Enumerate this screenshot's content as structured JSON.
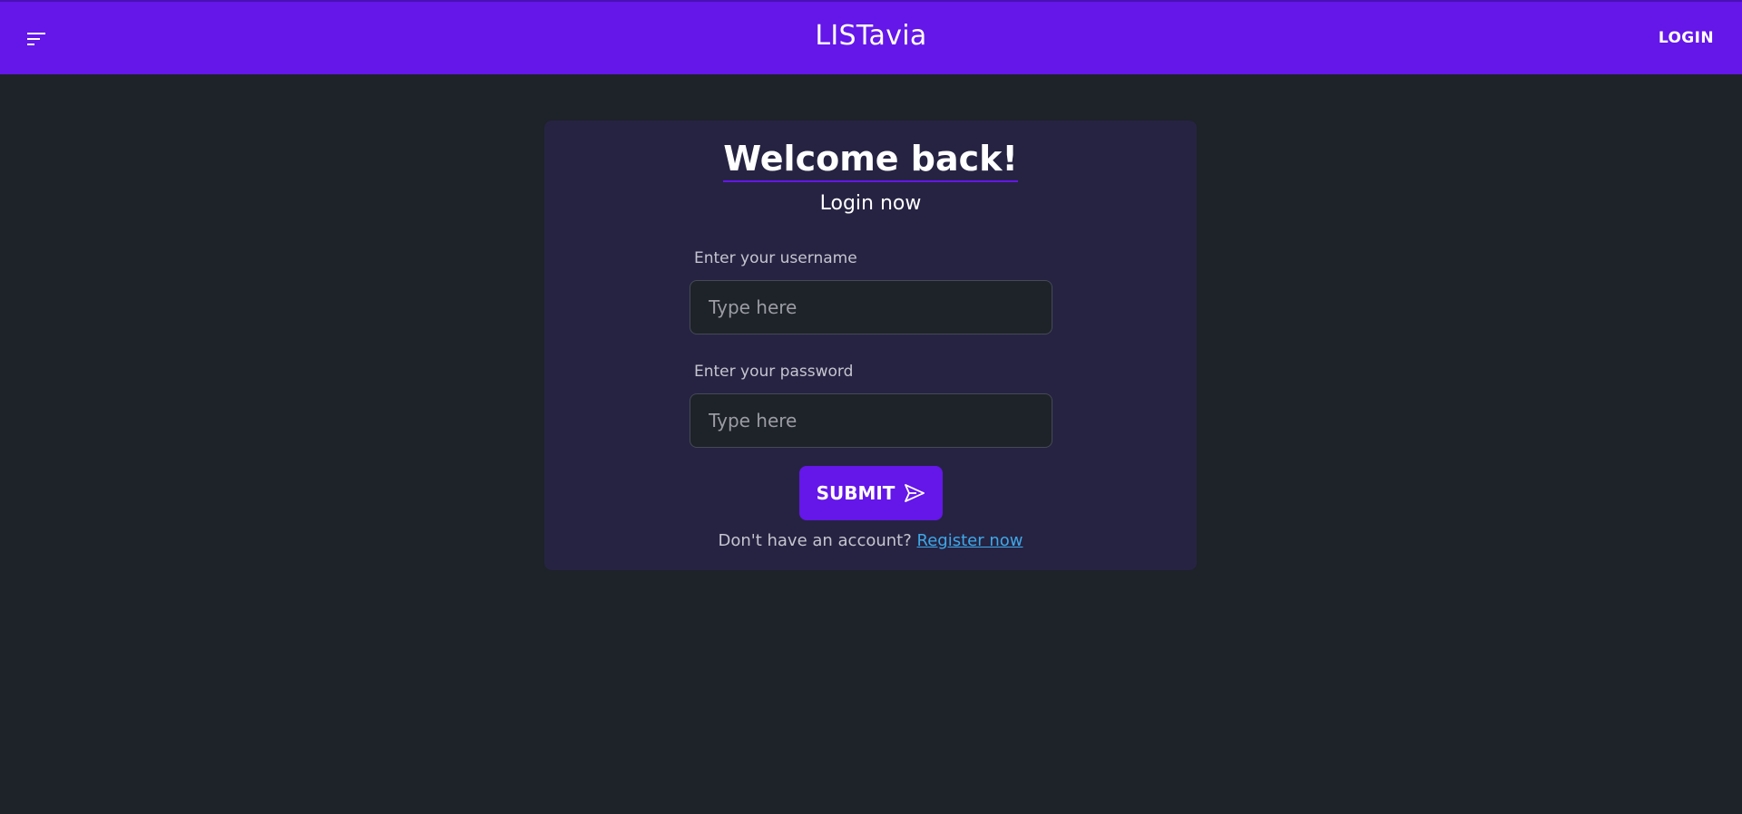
{
  "header": {
    "menu_icon": "menu-icon",
    "brand": "LISTavia",
    "login_label": "LOGIN"
  },
  "login_card": {
    "title": "Welcome back!",
    "subtitle": "Login now",
    "username_label": "Enter your username",
    "username_placeholder": "Type here",
    "username_value": "",
    "password_label": "Enter your password",
    "password_placeholder": "Type here",
    "password_value": "",
    "submit_label": "SUBMIT",
    "submit_icon": "send-icon",
    "no_account_text": "Don't have an account?",
    "register_label": "Register now"
  },
  "colors": {
    "accent": "#6417e8",
    "background": "#1e2229",
    "card": "#262342",
    "link": "#3fa8e8"
  }
}
